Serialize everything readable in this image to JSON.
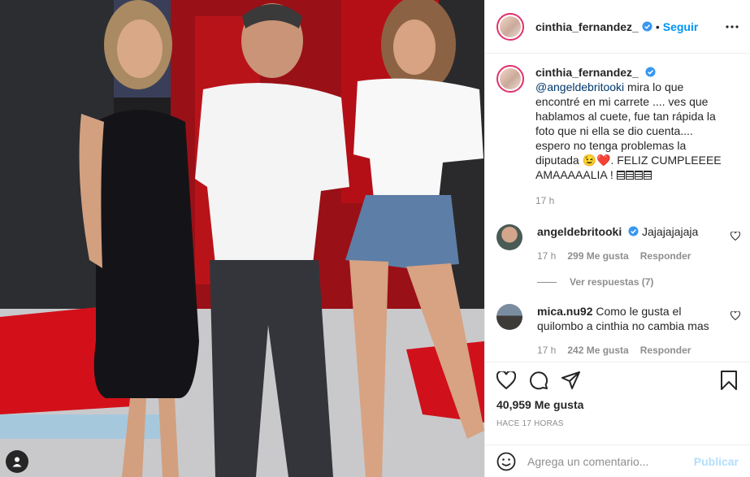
{
  "post": {
    "photo_alt": "",
    "header": {
      "username": "cinthia_fernandez_",
      "separator": "•",
      "follow_label": "Seguir"
    },
    "caption": {
      "username": "cinthia_fernandez_",
      "mention": "@angeldebritooki",
      "text": " mira lo que encontré en mi carrete .... ves que hablamos al cuete, fue tan rápida la foto que ni ella se dio cuenta.... espero no tenga problemas la diputada 😉❤️. FELIZ CUMPLEEEE AMAAAAALIA ! ",
      "time": "17 h"
    },
    "comments": [
      {
        "username": "angeldebritooki",
        "verified": true,
        "text": "Jajajajajaja",
        "time": "17 h",
        "likes": "299 Me gusta",
        "reply_label": "Responder",
        "view_replies": "Ver respuestas (7)"
      },
      {
        "username": "mica.nu92",
        "verified": false,
        "text": "Como le gusta el quilombo a cinthia no cambia mas",
        "time": "17 h",
        "likes": "242 Me gusta",
        "reply_label": "Responder"
      }
    ],
    "likes": "40,959 Me gusta",
    "posted_ago": "HACE 17 HORAS",
    "comment_input": {
      "placeholder": "Agrega un comentario...",
      "publish_label": "Publicar"
    }
  },
  "icons": {
    "verified": "verified-badge-icon",
    "more": "more-options-icon",
    "like": "heart-icon",
    "comment": "comment-icon",
    "share": "share-icon",
    "save": "bookmark-icon",
    "emoji": "emoji-icon",
    "tag": "user-tag-icon"
  },
  "colors": {
    "accent": "#0095f6",
    "verified": "#3897f0",
    "muted": "#8e8e8e",
    "publish_disabled": "#b2dffc"
  }
}
